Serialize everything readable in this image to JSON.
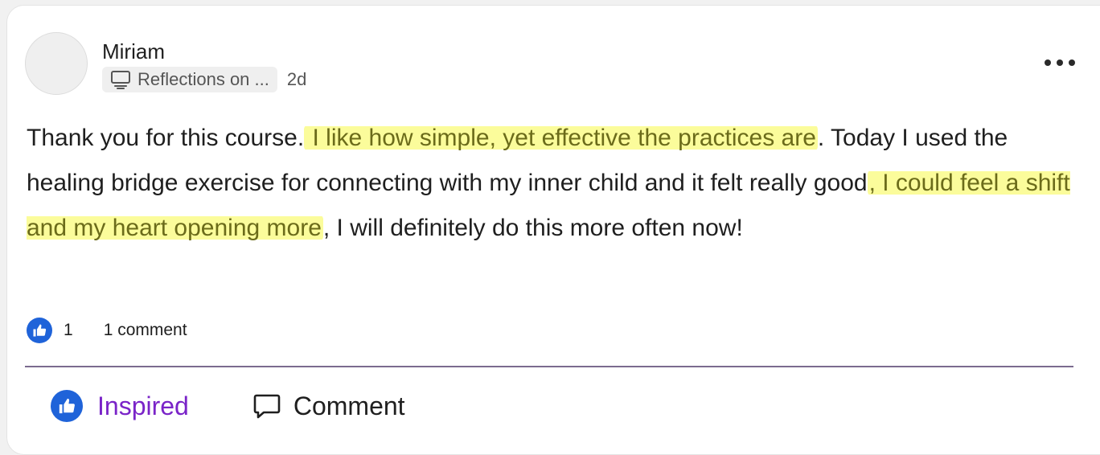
{
  "post": {
    "author": "Miriam",
    "space_label": "Reflections on ...",
    "time_ago": "2d",
    "body": {
      "p1": "Thank you for this course.",
      "h1": " I like how simple, yet effective the practices are",
      "p2": ". Today I used the healing bridge exercise for connecting with my inner child and it felt really good",
      "h2": ", I could feel a shift and my heart opening more",
      "p3": ", I will definitely do this more often now!"
    },
    "like_count": "1",
    "comment_count": "1 comment"
  },
  "actions": {
    "inspired_label": "Inspired",
    "comment_label": "Comment"
  },
  "colors": {
    "accent_blue": "#1f63d9",
    "inspired_purple": "#7a24c8",
    "highlight_yellow": "#fbfc9b",
    "divider": "#7b6b8f"
  },
  "icons": {
    "space": "monitor-icon",
    "more": "more-horizontal-icon",
    "like": "thumbs-up-icon",
    "comment": "comment-bubble-icon"
  }
}
